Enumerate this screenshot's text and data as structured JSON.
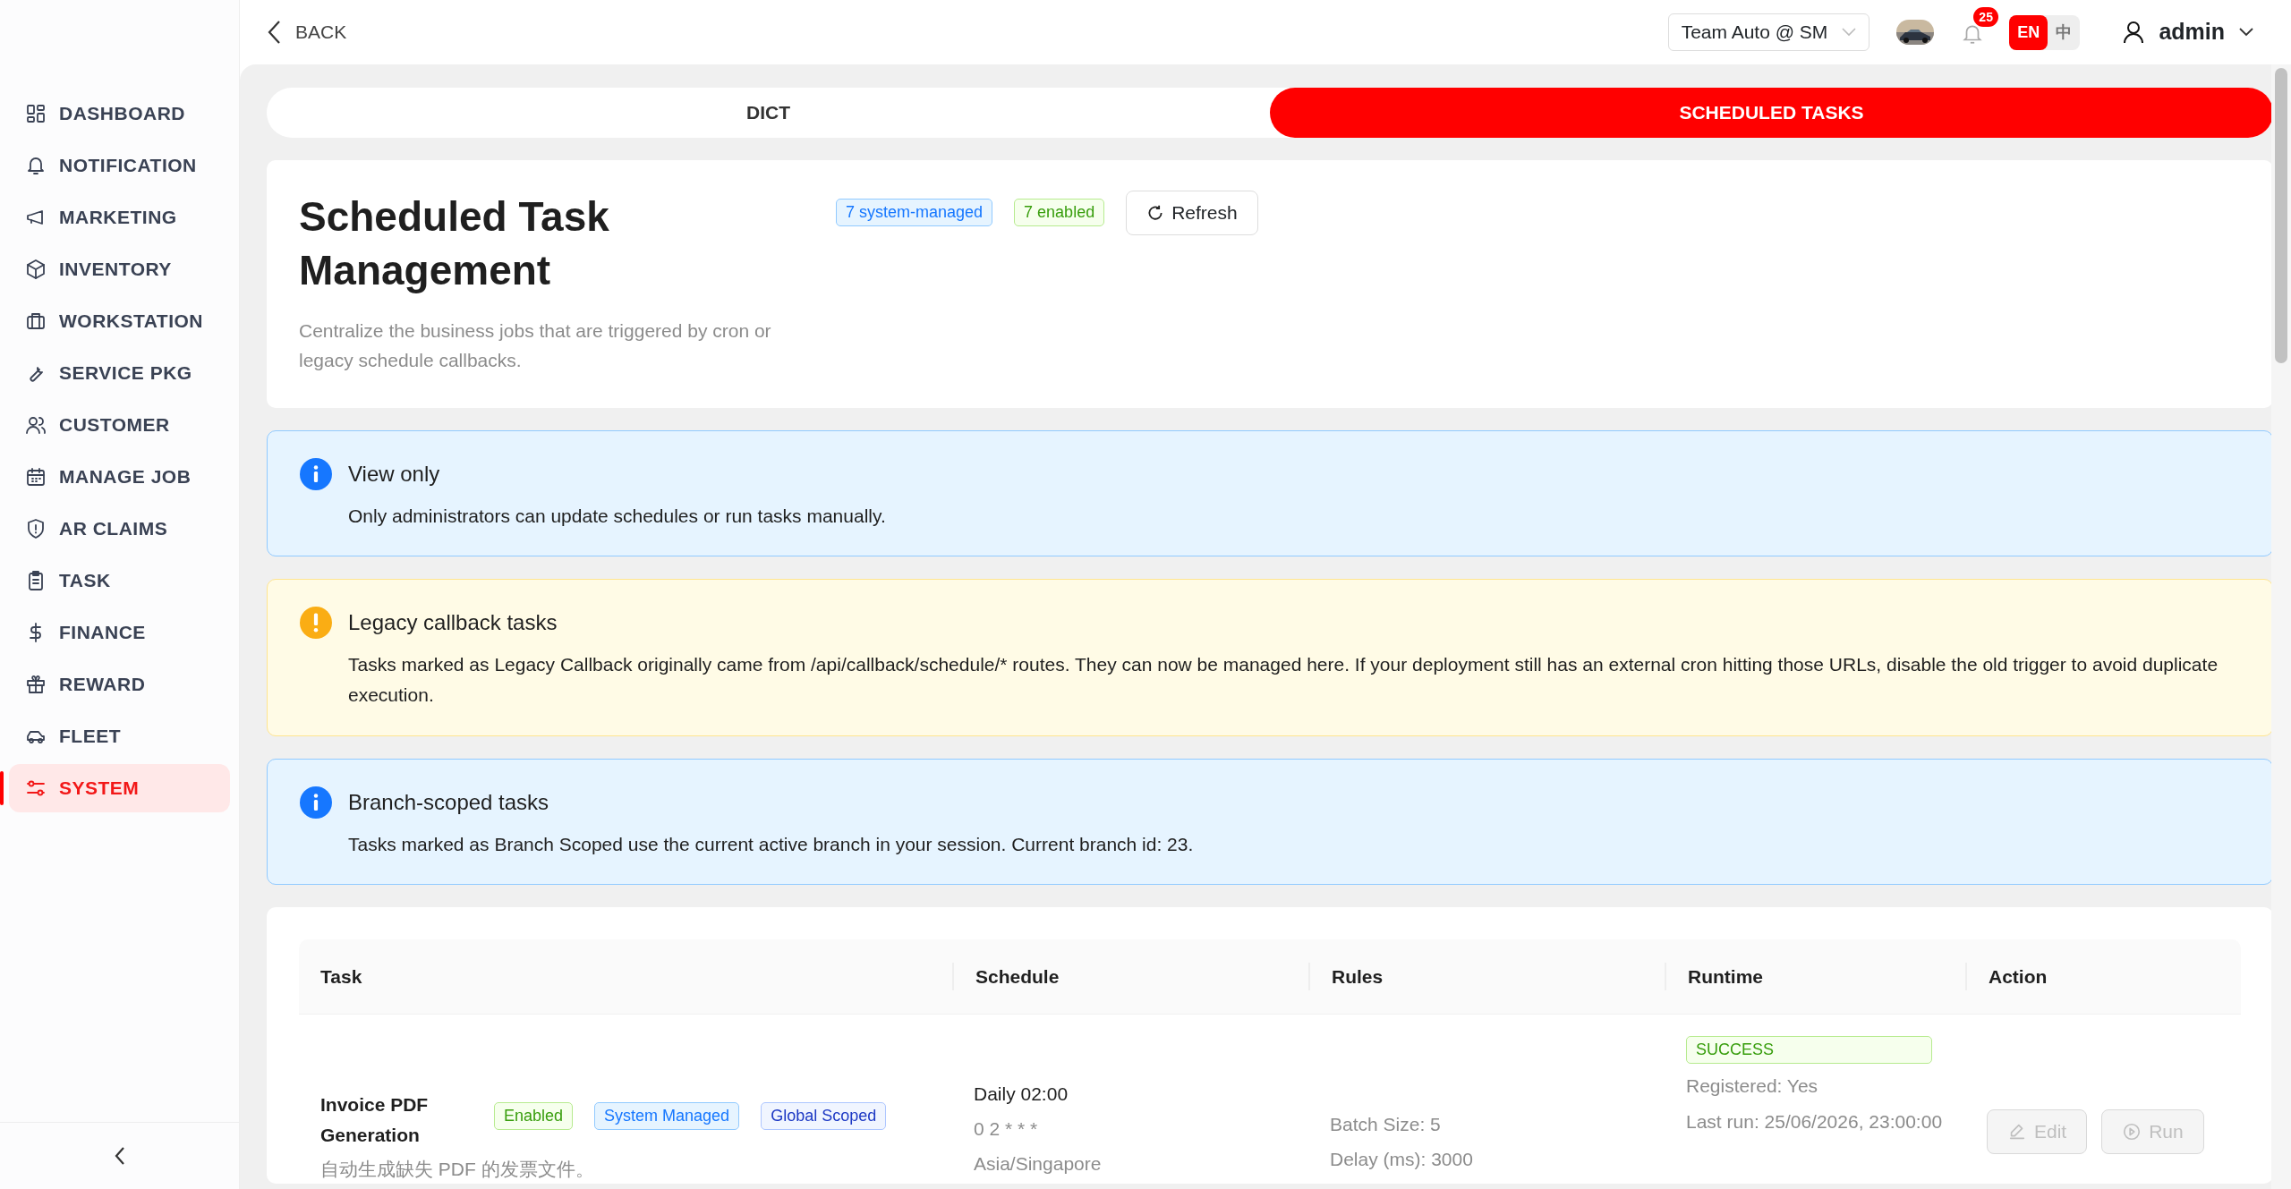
{
  "nav": {
    "back": "BACK",
    "branch": "Team Auto @ SM",
    "notifications": "25",
    "languages": [
      {
        "label": "EN",
        "selected": true
      },
      {
        "label": "中",
        "selected": false
      }
    ],
    "user": "admin"
  },
  "sidebar": {
    "items": [
      {
        "label": "DASHBOARD",
        "kind": "grid",
        "selected": false
      },
      {
        "label": "NOTIFICATION",
        "kind": "bell",
        "selected": false
      },
      {
        "label": "MARKETING",
        "kind": "megaphone",
        "selected": false
      },
      {
        "label": "INVENTORY",
        "kind": "box",
        "selected": false
      },
      {
        "label": "WORKSTATION",
        "kind": "briefcase",
        "selected": false
      },
      {
        "label": "SERVICE PKG",
        "kind": "wrench",
        "selected": false
      },
      {
        "label": "CUSTOMER",
        "kind": "users",
        "selected": false
      },
      {
        "label": "MANAGE JOB",
        "kind": "calendar",
        "selected": false
      },
      {
        "label": "AR CLAIMS",
        "kind": "shield",
        "selected": false
      },
      {
        "label": "TASK",
        "kind": "clipboard",
        "selected": false
      },
      {
        "label": "FINANCE",
        "kind": "dollar",
        "selected": false
      },
      {
        "label": "REWARD",
        "kind": "gift",
        "selected": false
      },
      {
        "label": "FLEET",
        "kind": "car",
        "selected": false
      },
      {
        "label": "SYSTEM",
        "kind": "sliders",
        "selected": true
      }
    ]
  },
  "tabs": [
    {
      "label": "DICT",
      "selected": false
    },
    {
      "label": "SCHEDULED TASKS",
      "selected": true
    }
  ],
  "header": {
    "title": "Scheduled Task Management",
    "subtitle": "Centralize the business jobs that are triggered by cron or legacy schedule callbacks.",
    "tags": [
      {
        "text": "7 system-managed",
        "kind": "info"
      },
      {
        "text": "7 enabled",
        "kind": "success"
      }
    ],
    "refresh": "Refresh"
  },
  "alerts": [
    {
      "kind": "info",
      "title": "View only",
      "text": "Only administrators can update schedules or run tasks manually."
    },
    {
      "kind": "warning",
      "title": "Legacy callback tasks",
      "text": "Tasks marked as Legacy Callback originally came from /api/callback/schedule/* routes. They can now be managed here. If your deployment still has an external cron hitting those URLs, disable the old trigger to avoid duplicate execution."
    },
    {
      "kind": "info",
      "title": "Branch-scoped tasks",
      "text": "Tasks marked as Branch Scoped use the current active branch in your session. Current branch id: 23."
    }
  ],
  "table": {
    "columns": [
      "Task",
      "Schedule",
      "Rules",
      "Runtime",
      "Action"
    ],
    "rows": [
      {
        "task": "Invoice PDF Generation",
        "description": "自动生成缺失 PDF 的发票文件。",
        "tags": [
          {
            "text": "Enabled",
            "kind": "success"
          },
          {
            "text": "System Managed",
            "kind": "info"
          },
          {
            "text": "Global Scoped",
            "kind": "scope"
          }
        ],
        "schedule": "Daily 02:00",
        "cron": "0 2 * * *",
        "timezone": "Asia/Singapore",
        "rules": [
          "Batch Size: 5",
          "Delay (ms): 3000"
        ],
        "status": "SUCCESS",
        "runtime": [
          "Registered: Yes",
          "Last run: 25/06/2026, 23:00:00"
        ],
        "actions": [
          {
            "label": "Edit",
            "kind": "edit",
            "disabled": true
          },
          {
            "label": "Run",
            "kind": "play",
            "disabled": true
          }
        ]
      }
    ]
  }
}
